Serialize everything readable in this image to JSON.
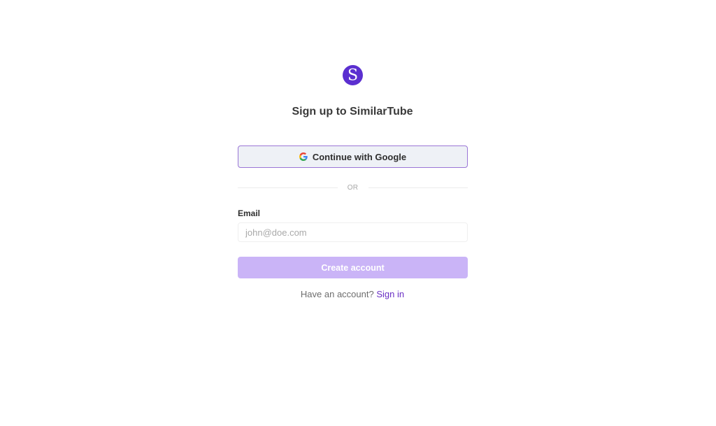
{
  "brand": {
    "logo_letter": "S",
    "logo_color": "#5b2fd0"
  },
  "title": "Sign up to SimilarTube",
  "google_button": {
    "label": "Continue with Google",
    "icon": "google-icon"
  },
  "divider_text": "OR",
  "email": {
    "label": "Email",
    "placeholder": "john@doe.com",
    "value": ""
  },
  "create_button": {
    "label": "Create account",
    "color": "#cab4f7"
  },
  "signin": {
    "prompt": "Have an account?",
    "link_label": "Sign in",
    "link_color": "#6a2fc4"
  }
}
